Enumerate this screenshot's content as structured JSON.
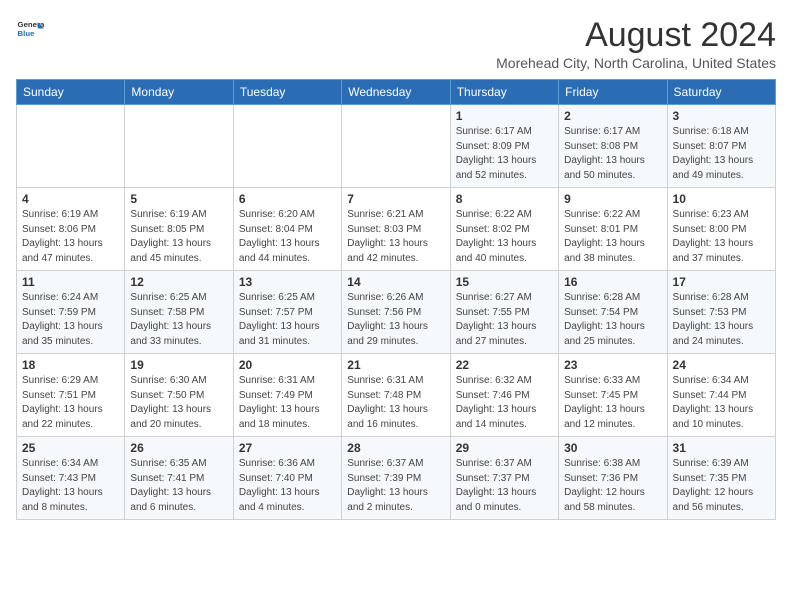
{
  "header": {
    "logo_line1": "General",
    "logo_line2": "Blue",
    "title": "August 2024",
    "subtitle": "Morehead City, North Carolina, United States"
  },
  "days_of_week": [
    "Sunday",
    "Monday",
    "Tuesday",
    "Wednesday",
    "Thursday",
    "Friday",
    "Saturday"
  ],
  "weeks": [
    [
      {
        "day": "",
        "info": ""
      },
      {
        "day": "",
        "info": ""
      },
      {
        "day": "",
        "info": ""
      },
      {
        "day": "",
        "info": ""
      },
      {
        "day": "1",
        "info": "Sunrise: 6:17 AM\nSunset: 8:09 PM\nDaylight: 13 hours\nand 52 minutes."
      },
      {
        "day": "2",
        "info": "Sunrise: 6:17 AM\nSunset: 8:08 PM\nDaylight: 13 hours\nand 50 minutes."
      },
      {
        "day": "3",
        "info": "Sunrise: 6:18 AM\nSunset: 8:07 PM\nDaylight: 13 hours\nand 49 minutes."
      }
    ],
    [
      {
        "day": "4",
        "info": "Sunrise: 6:19 AM\nSunset: 8:06 PM\nDaylight: 13 hours\nand 47 minutes."
      },
      {
        "day": "5",
        "info": "Sunrise: 6:19 AM\nSunset: 8:05 PM\nDaylight: 13 hours\nand 45 minutes."
      },
      {
        "day": "6",
        "info": "Sunrise: 6:20 AM\nSunset: 8:04 PM\nDaylight: 13 hours\nand 44 minutes."
      },
      {
        "day": "7",
        "info": "Sunrise: 6:21 AM\nSunset: 8:03 PM\nDaylight: 13 hours\nand 42 minutes."
      },
      {
        "day": "8",
        "info": "Sunrise: 6:22 AM\nSunset: 8:02 PM\nDaylight: 13 hours\nand 40 minutes."
      },
      {
        "day": "9",
        "info": "Sunrise: 6:22 AM\nSunset: 8:01 PM\nDaylight: 13 hours\nand 38 minutes."
      },
      {
        "day": "10",
        "info": "Sunrise: 6:23 AM\nSunset: 8:00 PM\nDaylight: 13 hours\nand 37 minutes."
      }
    ],
    [
      {
        "day": "11",
        "info": "Sunrise: 6:24 AM\nSunset: 7:59 PM\nDaylight: 13 hours\nand 35 minutes."
      },
      {
        "day": "12",
        "info": "Sunrise: 6:25 AM\nSunset: 7:58 PM\nDaylight: 13 hours\nand 33 minutes."
      },
      {
        "day": "13",
        "info": "Sunrise: 6:25 AM\nSunset: 7:57 PM\nDaylight: 13 hours\nand 31 minutes."
      },
      {
        "day": "14",
        "info": "Sunrise: 6:26 AM\nSunset: 7:56 PM\nDaylight: 13 hours\nand 29 minutes."
      },
      {
        "day": "15",
        "info": "Sunrise: 6:27 AM\nSunset: 7:55 PM\nDaylight: 13 hours\nand 27 minutes."
      },
      {
        "day": "16",
        "info": "Sunrise: 6:28 AM\nSunset: 7:54 PM\nDaylight: 13 hours\nand 25 minutes."
      },
      {
        "day": "17",
        "info": "Sunrise: 6:28 AM\nSunset: 7:53 PM\nDaylight: 13 hours\nand 24 minutes."
      }
    ],
    [
      {
        "day": "18",
        "info": "Sunrise: 6:29 AM\nSunset: 7:51 PM\nDaylight: 13 hours\nand 22 minutes."
      },
      {
        "day": "19",
        "info": "Sunrise: 6:30 AM\nSunset: 7:50 PM\nDaylight: 13 hours\nand 20 minutes."
      },
      {
        "day": "20",
        "info": "Sunrise: 6:31 AM\nSunset: 7:49 PM\nDaylight: 13 hours\nand 18 minutes."
      },
      {
        "day": "21",
        "info": "Sunrise: 6:31 AM\nSunset: 7:48 PM\nDaylight: 13 hours\nand 16 minutes."
      },
      {
        "day": "22",
        "info": "Sunrise: 6:32 AM\nSunset: 7:46 PM\nDaylight: 13 hours\nand 14 minutes."
      },
      {
        "day": "23",
        "info": "Sunrise: 6:33 AM\nSunset: 7:45 PM\nDaylight: 13 hours\nand 12 minutes."
      },
      {
        "day": "24",
        "info": "Sunrise: 6:34 AM\nSunset: 7:44 PM\nDaylight: 13 hours\nand 10 minutes."
      }
    ],
    [
      {
        "day": "25",
        "info": "Sunrise: 6:34 AM\nSunset: 7:43 PM\nDaylight: 13 hours\nand 8 minutes."
      },
      {
        "day": "26",
        "info": "Sunrise: 6:35 AM\nSunset: 7:41 PM\nDaylight: 13 hours\nand 6 minutes."
      },
      {
        "day": "27",
        "info": "Sunrise: 6:36 AM\nSunset: 7:40 PM\nDaylight: 13 hours\nand 4 minutes."
      },
      {
        "day": "28",
        "info": "Sunrise: 6:37 AM\nSunset: 7:39 PM\nDaylight: 13 hours\nand 2 minutes."
      },
      {
        "day": "29",
        "info": "Sunrise: 6:37 AM\nSunset: 7:37 PM\nDaylight: 13 hours\nand 0 minutes."
      },
      {
        "day": "30",
        "info": "Sunrise: 6:38 AM\nSunset: 7:36 PM\nDaylight: 12 hours\nand 58 minutes."
      },
      {
        "day": "31",
        "info": "Sunrise: 6:39 AM\nSunset: 7:35 PM\nDaylight: 12 hours\nand 56 minutes."
      }
    ]
  ]
}
